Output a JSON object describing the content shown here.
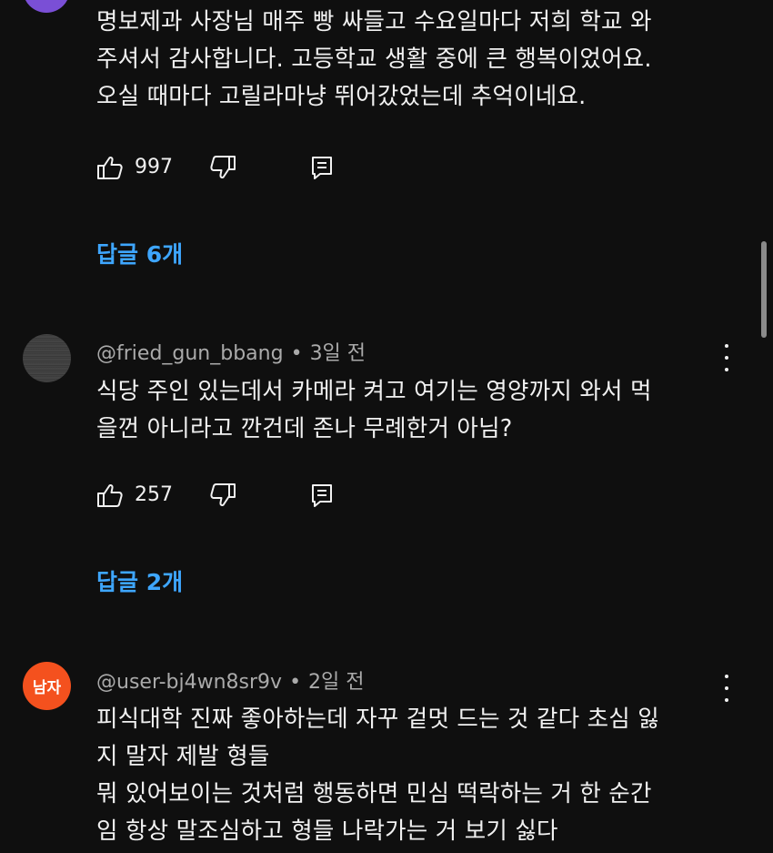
{
  "comment0": {
    "text": "명보제과 사장님 매주 빵 싸들고 수요일마다 저희 학교 와\n주셔서 감사합니다. 고등학교 생활 중에 큰 행복이었어요.\n오실 때마다 고릴라마냥 뛰어갔었는데 추억이네요.",
    "likes": "997",
    "replies": "답글 6개"
  },
  "comment1": {
    "author": "@fried_gun_bbang",
    "separator": "•",
    "time": "3일 전",
    "text": "식당 주인 있는데서 카메라 켜고 여기는 영양까지 와서 먹\n을껀 아니라고 깐건데 존나 무례한거 아님?",
    "likes": "257",
    "replies": "답글 2개"
  },
  "comment2": {
    "author": "@user-bj4wn8sr9v",
    "separator": "•",
    "time": "2일 전",
    "avatar_text": "남자",
    "avatar_color": "#f4511e",
    "text": "피식대학 진짜 좋아하는데 자꾸 겉멋 드는 것 같다 초심 잃\n지 말자 제발 형들\n뭐 있어보이는 것처럼 행동하면 민심 떡락하는 거 한 순간\n임 항상 말조심하고 형들 나락가는 거 보기 싫다"
  },
  "colors": {
    "background": "#0f0f0f",
    "text": "#f1f1f1",
    "meta": "#aaaaaa",
    "reply_link": "#3ea6ff"
  },
  "icons": {
    "like": "thumbs-up-icon",
    "dislike": "thumbs-down-icon",
    "reply": "reply-icon",
    "more": "more-vert-icon"
  }
}
